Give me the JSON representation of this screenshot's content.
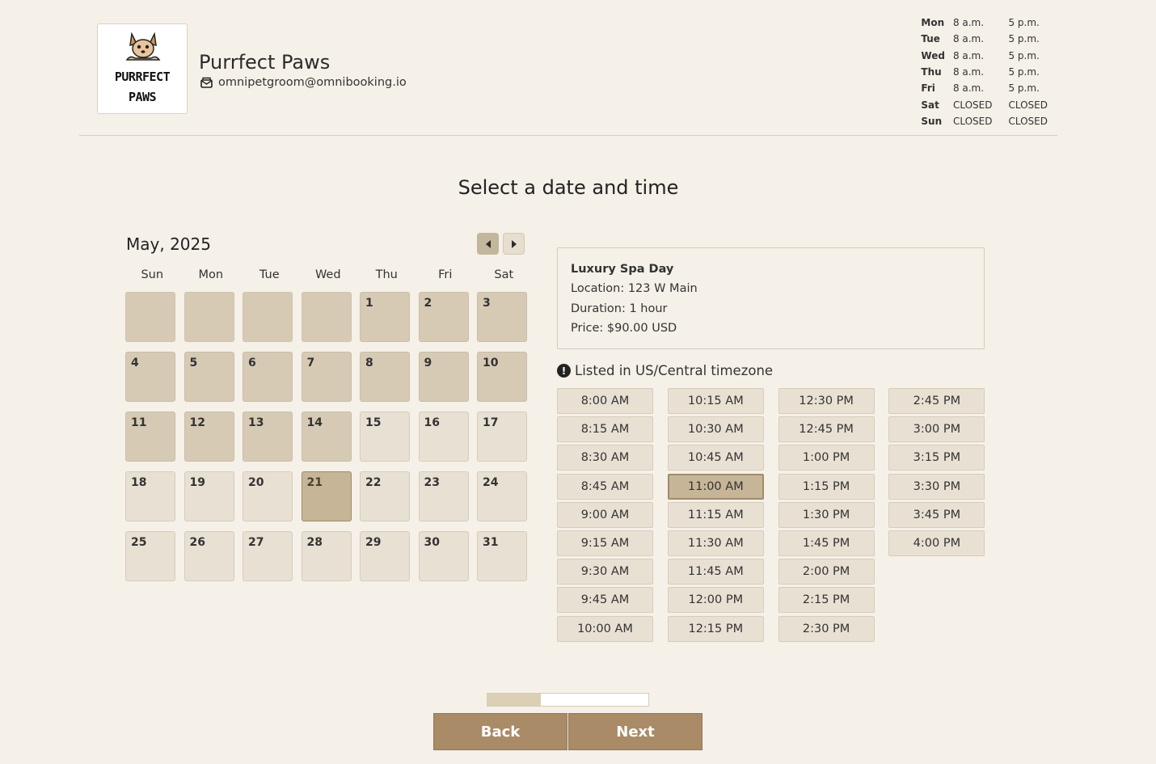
{
  "business": {
    "logo_line1": "PURRFECT",
    "logo_line2": "PAWS",
    "name": "Purrfect Paws",
    "email": "omnipetgroom@omnibooking.io",
    "email_icon": "envelope-icon"
  },
  "hours": [
    {
      "day": "Mon",
      "open": "8 a.m.",
      "close": "5 p.m."
    },
    {
      "day": "Tue",
      "open": "8 a.m.",
      "close": "5 p.m."
    },
    {
      "day": "Wed",
      "open": "8 a.m.",
      "close": "5 p.m."
    },
    {
      "day": "Thu",
      "open": "8 a.m.",
      "close": "5 p.m."
    },
    {
      "day": "Fri",
      "open": "8 a.m.",
      "close": "5 p.m."
    },
    {
      "day": "Sat",
      "open": "CLOSED",
      "close": "CLOSED"
    },
    {
      "day": "Sun",
      "open": "CLOSED",
      "close": "CLOSED"
    }
  ],
  "page_title": "Select a date and time",
  "calendar": {
    "month_label": "May, 2025",
    "prev_icon": "chevron-left-icon",
    "next_icon": "chevron-right-icon",
    "weekdays": [
      "Sun",
      "Mon",
      "Tue",
      "Wed",
      "Thu",
      "Fri",
      "Sat"
    ],
    "leading_blanks": 4,
    "days_in_month": 31,
    "last_past_day": 14,
    "selected_day": 21
  },
  "service": {
    "name": "Luxury Spa Day",
    "location": "Location: 123 W Main",
    "duration": "Duration: 1 hour",
    "price": "Price: $90.00 USD"
  },
  "timezone": {
    "icon": "alert-icon",
    "text": "Listed in US/Central timezone"
  },
  "slots": [
    "8:00 AM",
    "8:15 AM",
    "8:30 AM",
    "8:45 AM",
    "9:00 AM",
    "9:15 AM",
    "9:30 AM",
    "9:45 AM",
    "10:00 AM",
    "10:15 AM",
    "10:30 AM",
    "10:45 AM",
    "11:00 AM",
    "11:15 AM",
    "11:30 AM",
    "11:45 AM",
    "12:00 PM",
    "12:15 PM",
    "12:30 PM",
    "12:45 PM",
    "1:00 PM",
    "1:15 PM",
    "1:30 PM",
    "1:45 PM",
    "2:00 PM",
    "2:15 PM",
    "2:30 PM",
    "2:45 PM",
    "3:00 PM",
    "3:15 PM",
    "3:30 PM",
    "3:45 PM",
    "4:00 PM"
  ],
  "selected_slot": "11:00 AM",
  "progress": 0.33,
  "buttons": {
    "back": "Back",
    "next": "Next"
  },
  "colors": {
    "background": "#f5f0e8",
    "accent": "#a98b68",
    "selected": "#c6b597"
  }
}
